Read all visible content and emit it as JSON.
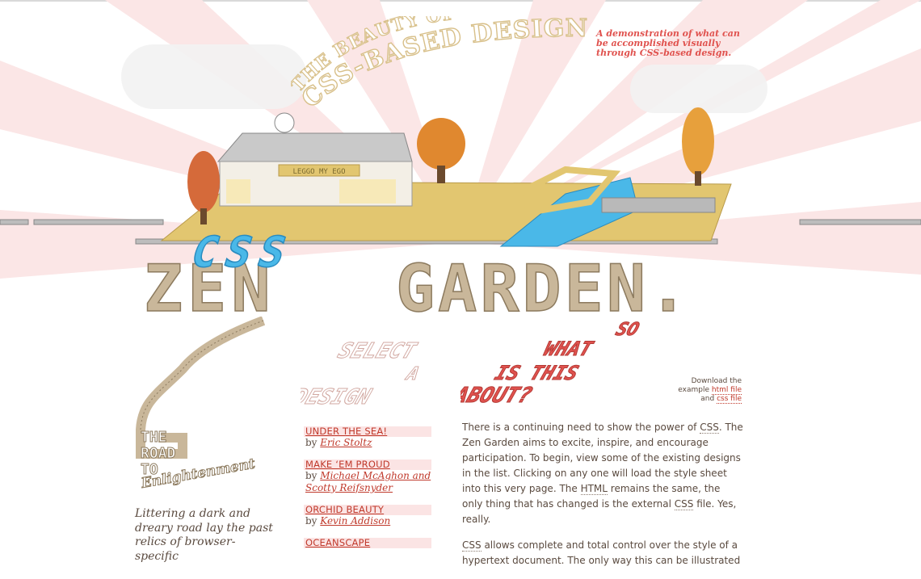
{
  "header": {
    "title_line1": "THE BEAUTY OF",
    "title_line2": "CSS-BASED DESIGN",
    "tagline": "A demonstration of what can be accomplished visually through CSS-based design."
  },
  "logo": {
    "sign_text": "LEGGO MY EGO",
    "word_zen": "ZEN",
    "word_css": "CSS",
    "word_garden": "GARDEN."
  },
  "sidebar": {
    "heading_art": [
      "THE",
      "ROAD",
      "TO",
      "Enlightenment"
    ],
    "intro_text": "Littering a dark and dreary road lay the past relics of browser-specific"
  },
  "select": {
    "heading_art": [
      "SELECT",
      "A",
      "DESIGN"
    ],
    "designs": [
      {
        "name": "UNDER THE SEA!",
        "by": "by",
        "author": "Eric Stoltz"
      },
      {
        "name": "MAKE ‘EM PROUD",
        "by": "by",
        "author": "Michael McAghon and Scotty Reifsnyder"
      },
      {
        "name": "ORCHID BEAUTY",
        "by": "by",
        "author": "Kevin Addison"
      },
      {
        "name": "OCEANSCAPE",
        "by": "",
        "author": ""
      }
    ]
  },
  "about": {
    "heading_art": [
      "SO",
      "WHAT",
      "IS THIS",
      "ABOUT?"
    ],
    "download": {
      "prefix": "Download the example",
      "html_link": "html file",
      "and": "and",
      "css_link": "css file"
    },
    "paragraph1": {
      "s1": "There is a continuing need to show the power of ",
      "abbr1": "CSS",
      "s2": ". The Zen Garden aims to excite, inspire, and encourage participation. To begin, view some of the existing designs in the list. Clicking on any one will load the style sheet into this very page. The ",
      "abbr2": "HTML",
      "s3": " remains the same, the only thing that has changed is the external ",
      "abbr3": "CSS",
      "s4": " file. Yes, really."
    },
    "paragraph2": {
      "abbr1": "CSS",
      "s1": " allows complete and total control over the style of a hypertext document. The only way this can be illustrated"
    }
  },
  "colors": {
    "accent": "#c0392b",
    "tagline": "#e0524e",
    "text": "#5a4a3f",
    "ray": "#fbe4e4",
    "brick_tan": "#c9b79a",
    "brick_blue": "#4ab8e8",
    "brick_gold": "#e2c670"
  }
}
